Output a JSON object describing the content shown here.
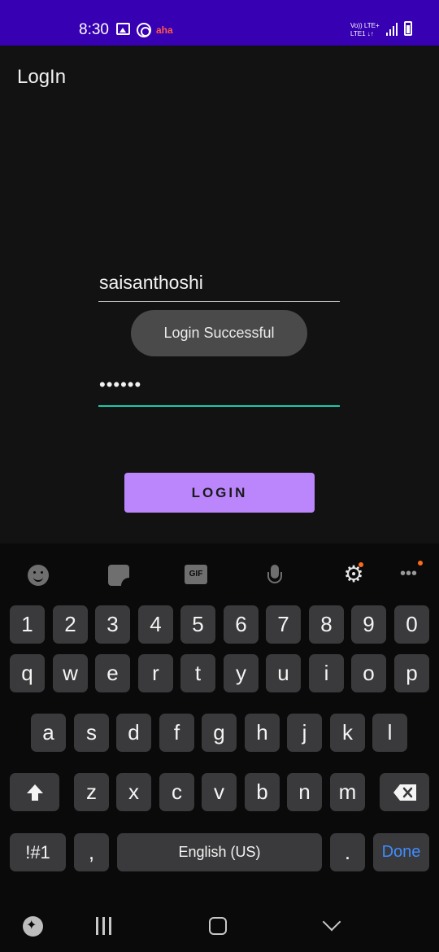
{
  "status_bar": {
    "time": "8:30",
    "carrier_badge": "aha",
    "network_line1": "Vo)) LTE+",
    "network_line2": "LTE1 ↓↑"
  },
  "app_bar": {
    "title": "LogIn"
  },
  "form": {
    "username_value": "saisanthoshi",
    "password_masked": "••••••",
    "login_label": "LOGIN"
  },
  "toast": {
    "message": "Login Successful"
  },
  "keyboard": {
    "toolbar": {
      "gif_label": "GIF"
    },
    "row_numbers": [
      "1",
      "2",
      "3",
      "4",
      "5",
      "6",
      "7",
      "8",
      "9",
      "0"
    ],
    "row_1": [
      "q",
      "w",
      "e",
      "r",
      "t",
      "y",
      "u",
      "i",
      "o",
      "p"
    ],
    "row_2": [
      "a",
      "s",
      "d",
      "f",
      "g",
      "h",
      "j",
      "k",
      "l"
    ],
    "row_3": [
      "z",
      "x",
      "c",
      "v",
      "b",
      "n",
      "m"
    ],
    "symbols_label": "!#1",
    "comma_label": ",",
    "space_label": "English (US)",
    "period_label": ".",
    "done_label": "Done"
  },
  "colors": {
    "status_bar": "#3700b3",
    "button": "#bb86fc",
    "focus_underline": "#1ec8a8",
    "done_text": "#3f8cff"
  },
  "icons": [
    "gallery-icon",
    "target-icon",
    "signal-icon",
    "battery-icon",
    "emoji-icon",
    "sticker-icon",
    "gif-icon",
    "mic-icon",
    "gear-icon",
    "more-icon",
    "shift-icon",
    "backspace-icon",
    "gamepad-icon",
    "recents-icon",
    "home-icon",
    "back-icon"
  ]
}
